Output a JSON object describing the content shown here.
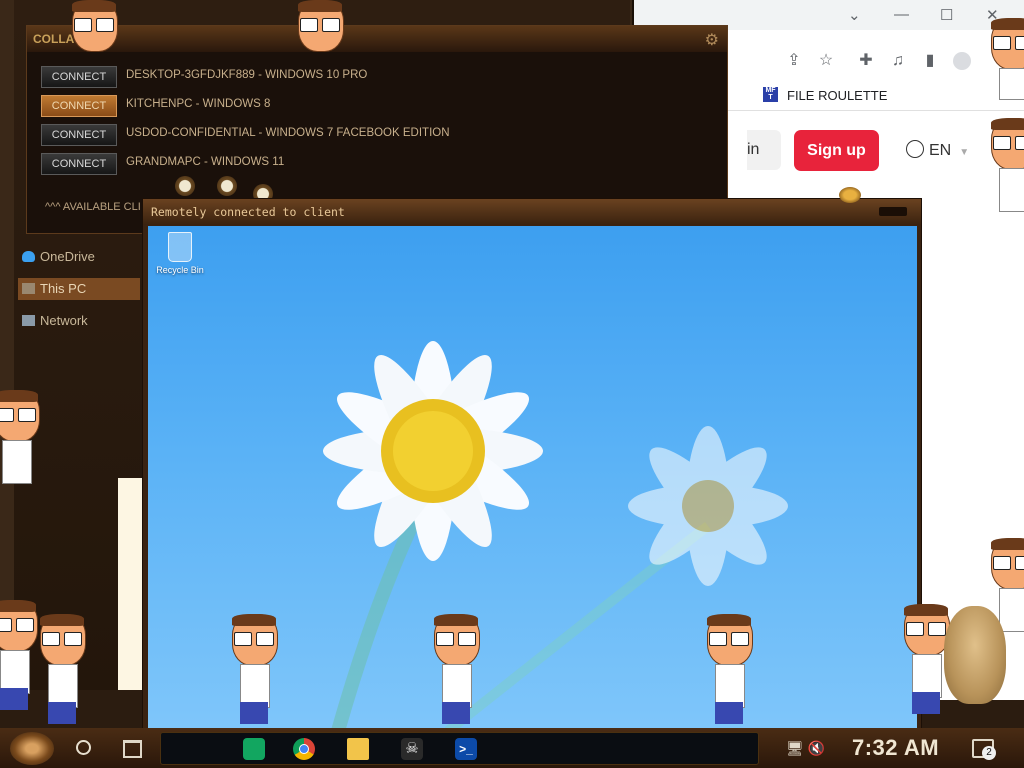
{
  "browser": {
    "window_controls": [
      "⌄",
      "—",
      "☐",
      "✕"
    ],
    "bookmark": {
      "favicon_text": "MF T",
      "label": "FILE ROULETTE"
    },
    "signin_fragment": "in",
    "signup_label": "Sign up",
    "language": "EN"
  },
  "explorer": {
    "nav": [
      {
        "label": "OneDrive",
        "icon": "onedrive-icon"
      },
      {
        "label": "This PC",
        "icon": "this-pc-icon",
        "active": true
      },
      {
        "label": "Network",
        "icon": "network-icon"
      }
    ]
  },
  "clients_window": {
    "title_fragment": "COLLA",
    "available_label": "^^^ AVAILABLE CLI",
    "clients": [
      {
        "button": "CONNECT",
        "name": "DESKTOP-3GFDJKF889 - WINDOWS 10 PRO",
        "highlighted": false
      },
      {
        "button": "CONNECT",
        "name": "KITCHENPC - WINDOWS 8",
        "highlighted": true
      },
      {
        "button": "CONNECT",
        "name": "USDOD-CONFIDENTIAL - WINDOWS 7 FACEBOOK EDITION",
        "highlighted": false
      },
      {
        "button": "CONNECT",
        "name": "GRANDMAPC - WINDOWS 11",
        "highlighted": false
      }
    ]
  },
  "remote_window": {
    "title": "Remotely connected to client",
    "desktop_icon_label": "Recycle Bin"
  },
  "taskbar": {
    "apps": [
      "sheets-icon",
      "chrome-icon",
      "file-explorer-icon",
      "skull-icon",
      "powershell-icon"
    ],
    "tray_icons": "🖥 🔇",
    "clock": "7:32 AM",
    "notification_count": "2"
  },
  "colors": {
    "signup_red": "#e8233b",
    "connect_highlight": "#c07a32",
    "desktop_blue": "#3d9ff0"
  }
}
